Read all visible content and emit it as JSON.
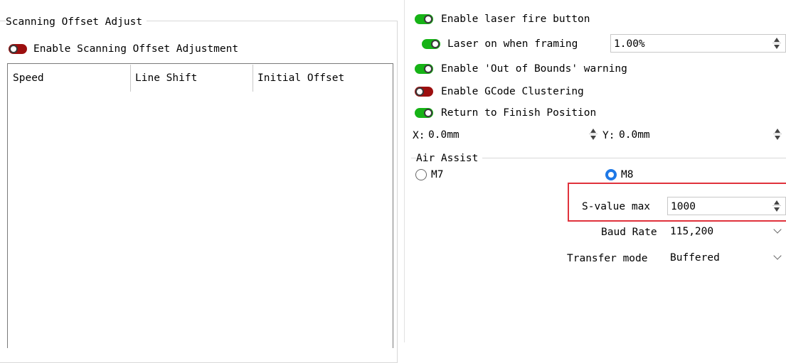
{
  "scanning": {
    "group_title": "Scanning Offset Adjust",
    "enable_label": "Enable Scanning Offset Adjustment",
    "enable_state": "off",
    "columns": [
      "Speed",
      "Line Shift",
      "Initial Offset"
    ]
  },
  "options": {
    "laser_fire": {
      "label": "Enable laser fire button",
      "state": "on"
    },
    "laser_framing": {
      "label": "Laser on when framing",
      "state": "on",
      "value": "1.00%"
    },
    "out_of_bounds": {
      "label": "Enable 'Out of Bounds' warning",
      "state": "on"
    },
    "gcode_clustering": {
      "label": "Enable GCode Clustering",
      "state": "off"
    },
    "return_finish": {
      "label": "Return to Finish Position",
      "state": "on"
    }
  },
  "position": {
    "x_label": "X:",
    "x_value": "0.0mm",
    "y_label": "Y:",
    "y_value": "0.0mm"
  },
  "air_assist": {
    "title": "Air Assist",
    "options": [
      {
        "label": "M7",
        "selected": false
      },
      {
        "label": "M8",
        "selected": true
      }
    ]
  },
  "s_value": {
    "label": "S-value max",
    "value": "1000"
  },
  "baud_rate": {
    "label": "Baud Rate",
    "value": "115,200"
  },
  "transfer_mode": {
    "label": "Transfer mode",
    "value": "Buffered"
  },
  "colors": {
    "toggle_on": "#16b316",
    "toggle_off": "#9c0f0f",
    "radio_selected": "#1e78e6",
    "highlight_box": "#e0323c"
  }
}
